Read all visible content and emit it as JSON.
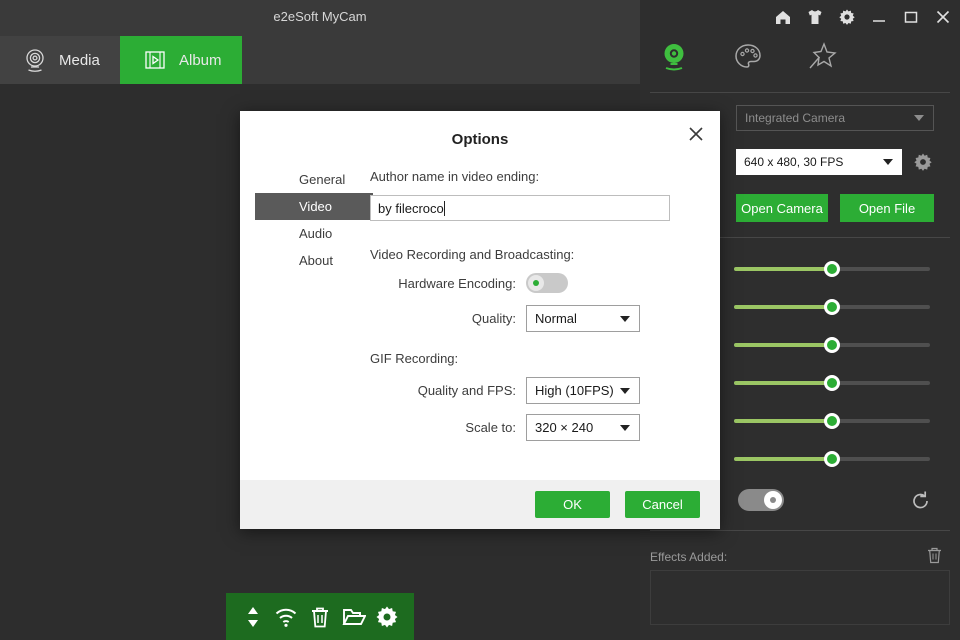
{
  "window": {
    "app_title": "e2eSoft MyCam",
    "controls": [
      {
        "name": "home-icon",
        "label": "Home"
      },
      {
        "name": "shirt-icon",
        "label": "Skin"
      },
      {
        "name": "gear-icon",
        "label": "Settings"
      },
      {
        "name": "minimize-icon",
        "label": "Minimize"
      },
      {
        "name": "maximize-icon",
        "label": "Maximize"
      },
      {
        "name": "close-icon",
        "label": "Close"
      }
    ]
  },
  "tabs": [
    {
      "id": "media",
      "label": "Media",
      "icon": "webcam-icon",
      "active": false
    },
    {
      "id": "album",
      "label": "Album",
      "icon": "film-icon",
      "active": true
    }
  ],
  "toolbar_icons": [
    {
      "name": "broadcast-icon"
    },
    {
      "name": "grid-icon"
    },
    {
      "name": "lock-icon"
    },
    {
      "name": "share-icon"
    },
    {
      "name": "collapse-icon"
    }
  ],
  "bottom_toolbar": [
    {
      "name": "sort-icon"
    },
    {
      "name": "wifi-icon"
    },
    {
      "name": "trash-icon"
    },
    {
      "name": "folder-open-icon"
    },
    {
      "name": "gear-icon"
    }
  ],
  "right_panel": {
    "mode_icons": [
      {
        "name": "webcam-icon",
        "active": true
      },
      {
        "name": "palette-icon",
        "active": false
      },
      {
        "name": "magic-star-icon",
        "active": false
      }
    ],
    "device_select": {
      "value": "Integrated Camera",
      "placeholder": "Integrated Camera"
    },
    "format_select": {
      "value": "640 x 480, 30 FPS"
    },
    "settings_icon": "gear-icon",
    "open_camera_label": "Open Camera",
    "open_file_label": "Open File",
    "sliders": [
      {
        "value": 50
      },
      {
        "value": 50
      },
      {
        "value": 50
      },
      {
        "value": 50
      },
      {
        "value": 50
      },
      {
        "value": 50
      }
    ],
    "power_toggle": {
      "state": "on"
    },
    "reset_icon": "reset-icon",
    "effects_label": "Effects Added:",
    "effects_trash_icon": "trash-icon"
  },
  "dialog": {
    "title": "Options",
    "close_icon": "close-icon",
    "nav": [
      {
        "label": "General",
        "active": false
      },
      {
        "label": "Video",
        "active": true
      },
      {
        "label": "Audio",
        "active": false
      },
      {
        "label": "About",
        "active": false
      }
    ],
    "author_label": "Author name in video ending:",
    "author_value": "by filecroco",
    "section_video_label": "Video Recording and Broadcasting:",
    "hardware_encoding_label": "Hardware Encoding:",
    "hardware_encoding_state": "off",
    "quality_label": "Quality:",
    "quality_value": "Normal",
    "section_gif_label": "GIF Recording:",
    "gif_quality_label": "Quality and FPS:",
    "gif_quality_value": "High (10FPS)",
    "scale_label": "Scale to:",
    "scale_value": "320 × 240",
    "ok_label": "OK",
    "cancel_label": "Cancel"
  },
  "colors": {
    "accent_green": "#2cad35",
    "panel_dark": "#2e2e2e",
    "titlebar": "#3a3a3a",
    "main_bg": "#2d2d2d"
  }
}
